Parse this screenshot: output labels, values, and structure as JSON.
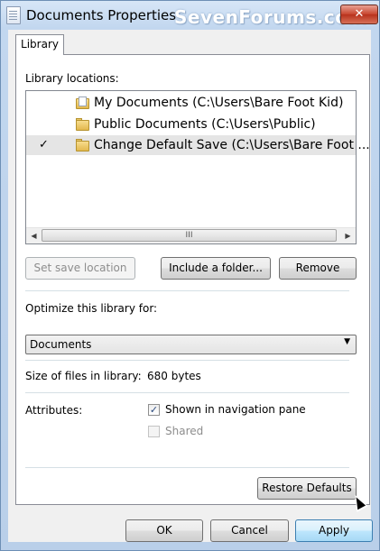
{
  "window": {
    "title": "Documents Properties",
    "watermark": "SevenForums.com",
    "close_label": "✕"
  },
  "tabs": [
    {
      "label": "Library",
      "active": true
    }
  ],
  "library": {
    "locations_label": "Library locations:",
    "locations": [
      {
        "name": "My Documents (C:\\Users\\Bare Foot Kid)",
        "is_default": false,
        "icon": "documents-folder-icon"
      },
      {
        "name": "Public Documents (C:\\Users\\Public)",
        "is_default": false,
        "icon": "folder-icon"
      },
      {
        "name": "Change Default Save (C:\\Users\\Bare Foot ...",
        "is_default": true,
        "check": "✓",
        "icon": "folder-icon",
        "selected": true
      }
    ],
    "scrollbar": {
      "left_arrow": "◀",
      "right_arrow": "▶",
      "thumb_grip": "III"
    },
    "buttons": {
      "set_save_location": "Set save location",
      "include_folder": "Include a folder...",
      "remove": "Remove"
    }
  },
  "optimize": {
    "label": "Optimize this library for:",
    "selected": "Documents",
    "arrow": "▼"
  },
  "size": {
    "label": "Size of files in library:",
    "value": "680 bytes"
  },
  "attributes": {
    "label": "Attributes:",
    "shown_in_nav": {
      "label": "Shown in navigation pane",
      "checked": true,
      "mark": "✓"
    },
    "shared": {
      "label": "Shared",
      "checked": false,
      "enabled": false
    }
  },
  "restore_defaults": "Restore Defaults",
  "footer": {
    "ok": "OK",
    "cancel": "Cancel",
    "apply": "Apply"
  },
  "colors": {
    "titlebar": "#c2d7ef",
    "close_button": "#c7442d",
    "selected_row": "#e5e5e5",
    "focus_button": "#bee6fd"
  }
}
